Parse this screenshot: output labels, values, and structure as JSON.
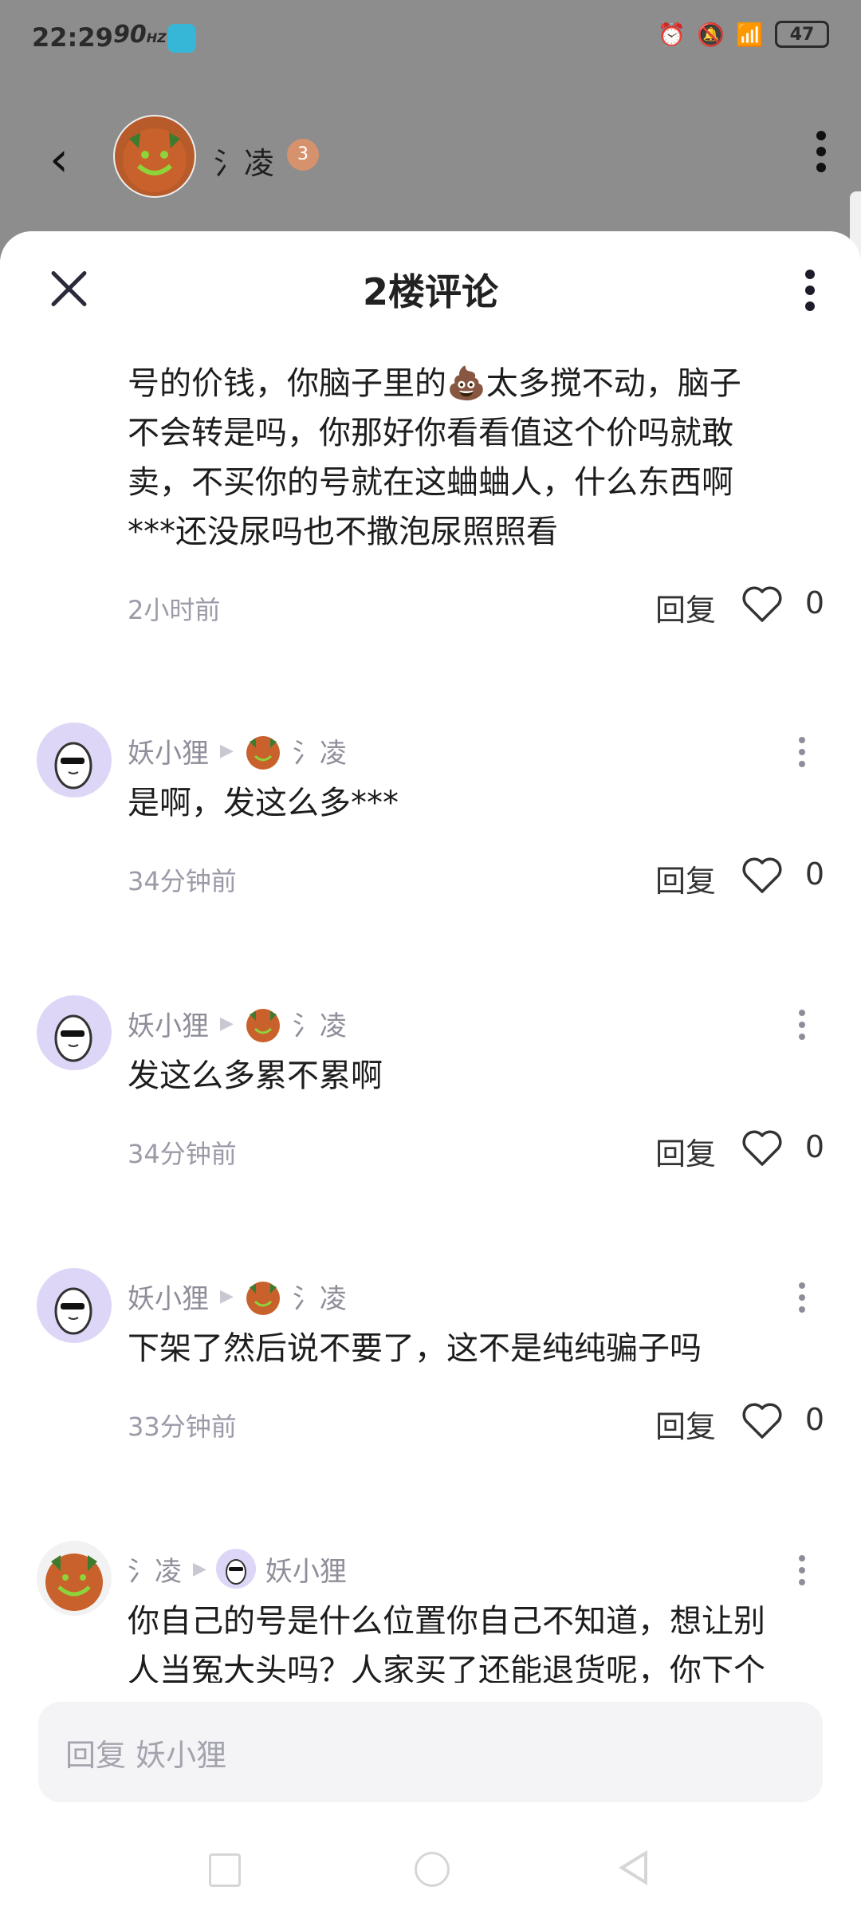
{
  "status_bar": {
    "time": "22:29",
    "refresh": "90",
    "refresh_unit": "HZ",
    "battery": "47"
  },
  "background_header": {
    "back_glyph": "‹",
    "username": "氵凌",
    "level": "3"
  },
  "sheet": {
    "title": "2楼评论"
  },
  "first_comment": {
    "lines": [
      "号的价钱，你脑子里的💩太多搅不动，脑子",
      "不会转是吗，你那好你看看值这个价吗就敢",
      "卖，不买你的号就在这蛐蛐人，什么东西啊",
      "***还没尿吗也不撒泡尿照照看"
    ],
    "time": "2小时前",
    "reply": "回复",
    "likes": "0"
  },
  "comments": [
    {
      "author": "妖小狸",
      "to": "氵凌",
      "text": "是啊，发这么多***",
      "time": "34分钟前",
      "reply": "回复",
      "likes": "0"
    },
    {
      "author": "妖小狸",
      "to": "氵凌",
      "text": "发这么多累不累啊",
      "time": "34分钟前",
      "reply": "回复",
      "likes": "0"
    },
    {
      "author": "妖小狸",
      "to": "氵凌",
      "text": "下架了然后说不要了，这不是纯纯骗子吗",
      "time": "33分钟前",
      "reply": "回复",
      "likes": "0"
    },
    {
      "author": "氵凌",
      "to": "妖小狸",
      "text_lines": [
        "你自己的号是什么位置你自己不知道，想让别",
        "人当冤大头吗？人家买了还能退货呢，你下个"
      ]
    }
  ],
  "reply_input": {
    "placeholder": "回复 妖小狸"
  }
}
